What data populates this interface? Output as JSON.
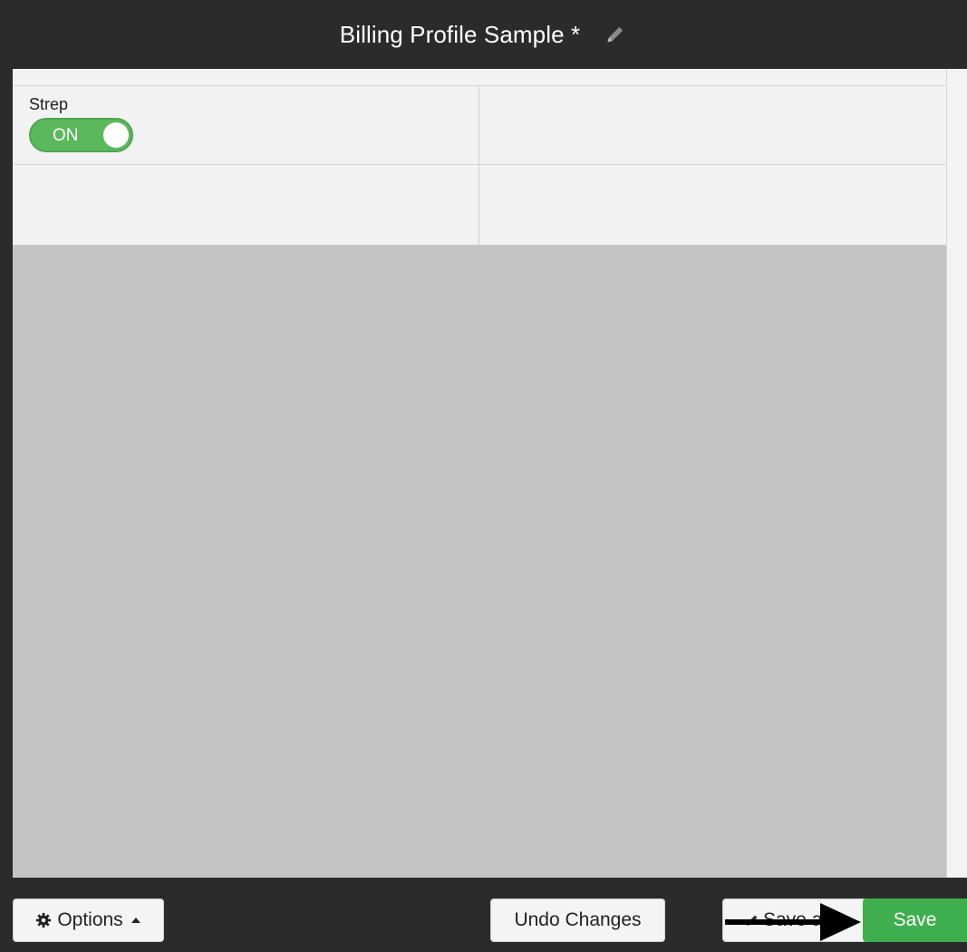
{
  "header": {
    "title": "Billing Profile Sample *",
    "edit_icon": "pencil-icon"
  },
  "grid": {
    "cells": [
      {
        "label": "Strep",
        "toggle": {
          "state_label": "ON",
          "on": true,
          "color": "#5cb85c"
        }
      },
      {},
      {},
      {}
    ]
  },
  "footer": {
    "options_label": "Options",
    "undo_label": "Undo Changes",
    "save_as_label": "Save a",
    "save_label": "Save",
    "save_color": "#3fae4f"
  },
  "annotation": {
    "arrow_icon": "arrow-right-icon"
  }
}
